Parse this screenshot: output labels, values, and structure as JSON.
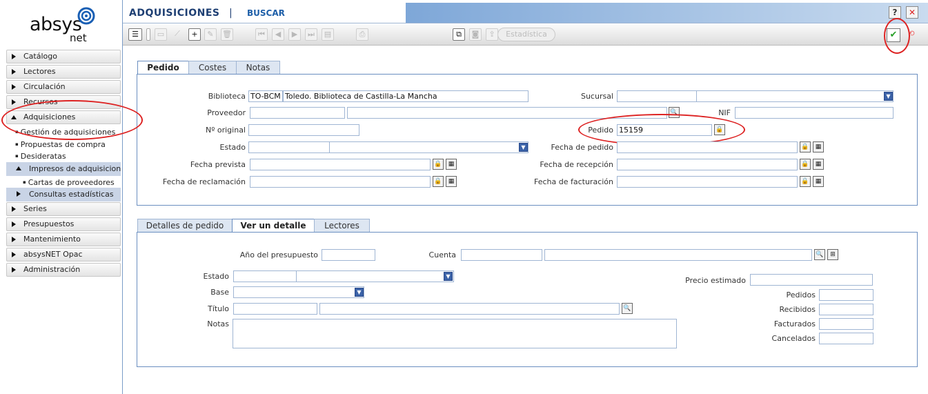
{
  "app": {
    "brand": "absys",
    "brand_sub": "net"
  },
  "header": {
    "title": "ADQUISICIONES",
    "separator": "|",
    "mode": "BUSCAR",
    "help": "?",
    "close": "✕"
  },
  "sidebar": {
    "items": [
      {
        "label": "Catálogo"
      },
      {
        "label": "Lectores"
      },
      {
        "label": "Circulación"
      },
      {
        "label": "Recursos"
      },
      {
        "label": "Adquisiciones"
      }
    ],
    "adq_sub": [
      {
        "label": "Gestión de adquisiciones"
      },
      {
        "label": "Propuestas de compra"
      },
      {
        "label": "Desideratas"
      }
    ],
    "impresos": "Impresos de adquisiciones",
    "cartas": "Cartas de proveedores",
    "consultas": "Consultas estadísticas",
    "rest": [
      {
        "label": "Series"
      },
      {
        "label": "Presupuestos"
      },
      {
        "label": "Mantenimiento"
      },
      {
        "label": "absysNET Opac"
      },
      {
        "label": "Administración"
      }
    ]
  },
  "toolbar": {
    "stat_label": "Estadística"
  },
  "top_tabs": [
    {
      "label": "Pedido"
    },
    {
      "label": "Costes"
    },
    {
      "label": "Notas"
    }
  ],
  "pedido": {
    "biblioteca_label": "Biblioteca",
    "biblioteca_code": "TO-BCM",
    "biblioteca_name": "Toledo. Biblioteca de Castilla-La Mancha",
    "sucursal_label": "Sucursal",
    "proveedor_label": "Proveedor",
    "nif_label": "NIF",
    "norig_label": "Nº original",
    "pedido_label": "Pedido",
    "pedido_value": "15159",
    "estado_label": "Estado",
    "fecha_pedido_label": "Fecha de pedido",
    "fecha_prevista_label": "Fecha prevista",
    "fecha_recepcion_label": "Fecha de recepción",
    "fecha_reclamacion_label": "Fecha de reclamación",
    "fecha_facturacion_label": "Fecha de facturación"
  },
  "bottom_tabs": [
    {
      "label": "Detalles de pedido"
    },
    {
      "label": "Ver un detalle"
    },
    {
      "label": "Lectores"
    }
  ],
  "detalle": {
    "anio_label": "Año del presupuesto",
    "cuenta_label": "Cuenta",
    "estado_label": "Estado",
    "base_label": "Base",
    "titulo_label": "Título",
    "notas_label": "Notas",
    "precio_label": "Precio estimado",
    "pedidos_label": "Pedidos",
    "recibidos_label": "Recibidos",
    "facturados_label": "Facturados",
    "cancelados_label": "Cancelados"
  },
  "colors": {
    "accent": "#1e3f73",
    "panel_border": "#6a8ec0",
    "highlight": "#dd2222"
  }
}
